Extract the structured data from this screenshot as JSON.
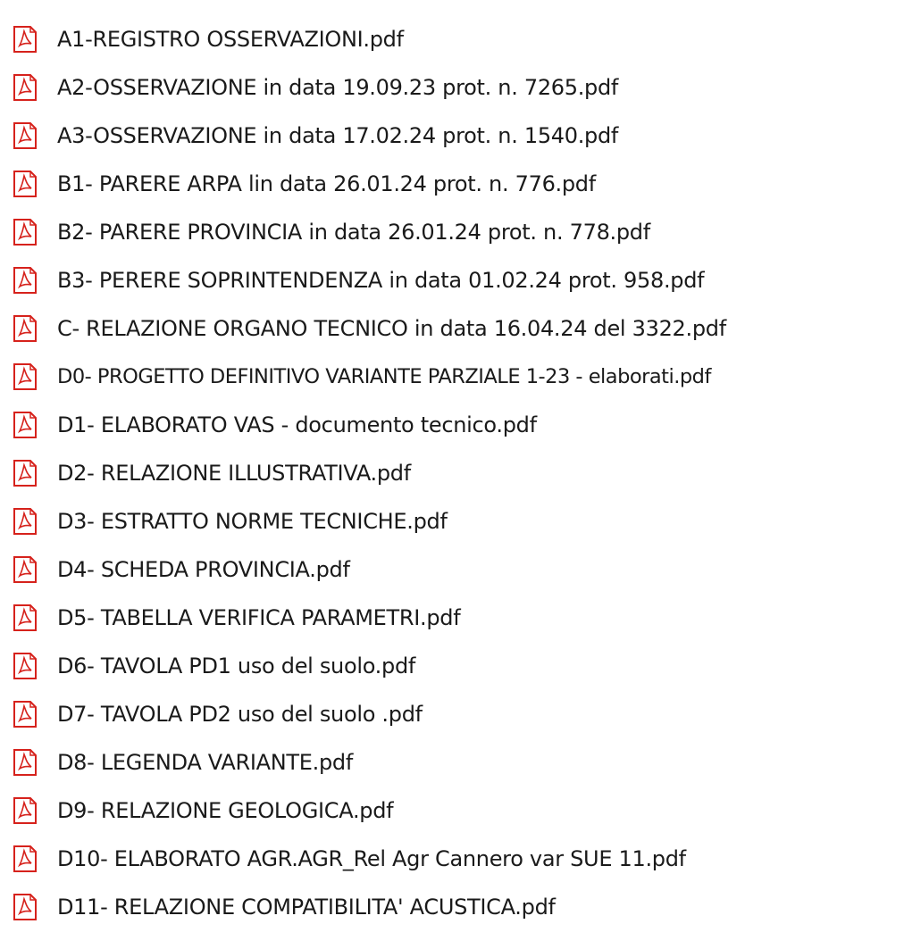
{
  "files": [
    {
      "name": "A1-REGISTRO OSSERVAZIONI.pdf",
      "icon": "pdf-file-icon"
    },
    {
      "name": "A2-OSSERVAZIONE in data 19.09.23 prot. n. 7265.pdf",
      "icon": "pdf-file-icon"
    },
    {
      "name": "A3-OSSERVAZIONE in data 17.02.24 prot. n. 1540.pdf",
      "icon": "pdf-file-icon"
    },
    {
      "name": "B1- PARERE ARPA lin data 26.01.24 prot. n. 776.pdf",
      "icon": "pdf-file-icon"
    },
    {
      "name": "B2- PARERE PROVINCIA in data 26.01.24 prot. n. 778.pdf",
      "icon": "pdf-file-icon"
    },
    {
      "name": "B3- PERERE SOPRINTENDENZA in data 01.02.24 prot. 958.pdf",
      "icon": "pdf-file-icon"
    },
    {
      "name": "C- RELAZIONE ORGANO TECNICO in data 16.04.24 del 3322.pdf",
      "icon": "pdf-file-icon"
    },
    {
      "name": "D0- PROGETTO DEFINITIVO VARIANTE PARZIALE 1-23 - elaborati.pdf",
      "icon": "pdf-file-icon"
    },
    {
      "name": "D1- ELABORATO VAS - documento tecnico.pdf",
      "icon": "pdf-file-icon"
    },
    {
      "name": "D2- RELAZIONE ILLUSTRATIVA.pdf",
      "icon": "pdf-file-icon"
    },
    {
      "name": "D3- ESTRATTO NORME TECNICHE.pdf",
      "icon": "pdf-file-icon"
    },
    {
      "name": "D4- SCHEDA PROVINCIA.pdf",
      "icon": "pdf-file-icon"
    },
    {
      "name": "D5- TABELLA VERIFICA PARAMETRI.pdf",
      "icon": "pdf-file-icon"
    },
    {
      "name": "D6- TAVOLA PD1 uso del suolo.pdf",
      "icon": "pdf-file-icon"
    },
    {
      "name": "D7- TAVOLA PD2 uso del suolo .pdf",
      "icon": "pdf-file-icon"
    },
    {
      "name": "D8- LEGENDA VARIANTE.pdf",
      "icon": "pdf-file-icon"
    },
    {
      "name": "D9- RELAZIONE GEOLOGICA.pdf",
      "icon": "pdf-file-icon"
    },
    {
      "name": "D10- ELABORATO AGR.AGR_Rel Agr Cannero var SUE 11.pdf",
      "icon": "pdf-file-icon"
    },
    {
      "name": "D11- RELAZIONE COMPATIBILITA' ACUSTICA.pdf",
      "icon": "pdf-file-icon"
    }
  ],
  "colors": {
    "icon_red": "#d6221c",
    "text": "#1a1a1a",
    "background": "#ffffff"
  }
}
